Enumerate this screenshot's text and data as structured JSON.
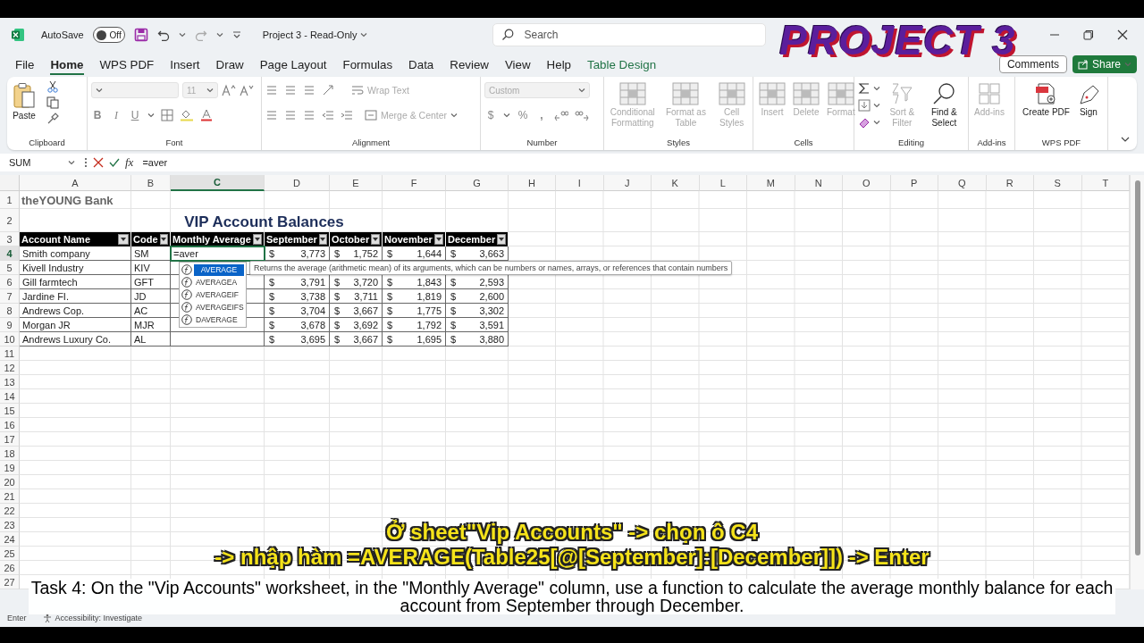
{
  "title_bar": {
    "autosave_label": "AutoSave",
    "autosave": {
      "on": false,
      "label": "Off"
    },
    "document_title": "Project 3  -  Read-Only",
    "search": {
      "placeholder": "Search"
    }
  },
  "overlay_title": "PROJECT 3",
  "ribbon_tabs": [
    {
      "label": "File",
      "selected": false,
      "contextual": false
    },
    {
      "label": "Home",
      "selected": true,
      "contextual": false
    },
    {
      "label": "WPS PDF",
      "selected": false,
      "contextual": false
    },
    {
      "label": "Insert",
      "selected": false,
      "contextual": false
    },
    {
      "label": "Draw",
      "selected": false,
      "contextual": false
    },
    {
      "label": "Page Layout",
      "selected": false,
      "contextual": false
    },
    {
      "label": "Formulas",
      "selected": false,
      "contextual": false
    },
    {
      "label": "Data",
      "selected": false,
      "contextual": false
    },
    {
      "label": "Review",
      "selected": false,
      "contextual": false
    },
    {
      "label": "View",
      "selected": false,
      "contextual": false
    },
    {
      "label": "Help",
      "selected": false,
      "contextual": false
    },
    {
      "label": "Table Design",
      "selected": false,
      "contextual": true
    }
  ],
  "comments_button": "Comments",
  "share_button": "Share",
  "ribbon": {
    "clipboard": {
      "label": "Clipboard",
      "paste": "Paste"
    },
    "font": {
      "label": "Font",
      "size": "11",
      "bold": "B",
      "italic": "I",
      "underline": "U"
    },
    "alignment": {
      "label": "Alignment",
      "wrap_text": "Wrap Text",
      "merge_center": "Merge & Center"
    },
    "number": {
      "label": "Number",
      "format": "Custom",
      "currency": "$",
      "percent": "%",
      "comma": ","
    },
    "styles": {
      "label": "Styles",
      "buttons": [
        {
          "label": "Conditional Formatting",
          "disabled": true
        },
        {
          "label": "Format as Table",
          "disabled": true
        },
        {
          "label": "Cell Styles",
          "disabled": true
        }
      ]
    },
    "cells": {
      "label": "Cells",
      "buttons": [
        {
          "label": "Insert",
          "disabled": true
        },
        {
          "label": "Delete",
          "disabled": true
        },
        {
          "label": "Format",
          "disabled": true
        }
      ]
    },
    "editing": {
      "label": "Editing",
      "buttons": [
        {
          "label": "Sort & Filter",
          "disabled": true
        },
        {
          "label": "Find & Select",
          "disabled": false
        }
      ]
    },
    "addins": {
      "label": "Add-ins",
      "buttons": [
        {
          "label": "Add-ins",
          "disabled": true
        }
      ]
    },
    "wps_pdf": {
      "label": "WPS PDF",
      "buttons": [
        {
          "label": "Create PDF",
          "disabled": false
        },
        {
          "label": "Sign",
          "disabled": false
        }
      ]
    }
  },
  "formula_bar": {
    "name_box": "SUM",
    "fx": "fx",
    "formula": "=aver"
  },
  "sheet": {
    "column_headers": [
      {
        "label": "A",
        "selected": false
      },
      {
        "label": "B",
        "selected": false
      },
      {
        "label": "C",
        "selected": true
      },
      {
        "label": "D",
        "selected": false
      },
      {
        "label": "E",
        "selected": false
      },
      {
        "label": "F",
        "selected": false
      },
      {
        "label": "G",
        "selected": false
      },
      {
        "label": "H",
        "selected": false
      },
      {
        "label": "I",
        "selected": false
      },
      {
        "label": "J",
        "selected": false
      },
      {
        "label": "K",
        "selected": false
      },
      {
        "label": "L",
        "selected": false
      },
      {
        "label": "M",
        "selected": false
      },
      {
        "label": "N",
        "selected": false
      },
      {
        "label": "O",
        "selected": false
      },
      {
        "label": "P",
        "selected": false
      },
      {
        "label": "Q",
        "selected": false
      },
      {
        "label": "R",
        "selected": false
      },
      {
        "label": "S",
        "selected": false
      },
      {
        "label": "T",
        "selected": false
      }
    ],
    "row_headers": [
      {
        "label": "1",
        "selected": false
      },
      {
        "label": "2",
        "selected": false
      },
      {
        "label": "3",
        "selected": false
      },
      {
        "label": "4",
        "selected": true
      },
      {
        "label": "5",
        "selected": false
      },
      {
        "label": "6",
        "selected": false
      },
      {
        "label": "7",
        "selected": false
      },
      {
        "label": "8",
        "selected": false
      },
      {
        "label": "9",
        "selected": false
      },
      {
        "label": "10",
        "selected": false
      },
      {
        "label": "11",
        "selected": false
      },
      {
        "label": "12",
        "selected": false
      },
      {
        "label": "13",
        "selected": false
      },
      {
        "label": "14",
        "selected": false
      },
      {
        "label": "15",
        "selected": false
      },
      {
        "label": "16",
        "selected": false
      },
      {
        "label": "17",
        "selected": false
      },
      {
        "label": "18",
        "selected": false
      },
      {
        "label": "19",
        "selected": false
      },
      {
        "label": "20",
        "selected": false
      },
      {
        "label": "21",
        "selected": false
      },
      {
        "label": "22",
        "selected": false
      },
      {
        "label": "23",
        "selected": false
      },
      {
        "label": "24",
        "selected": false
      },
      {
        "label": "25",
        "selected": false
      },
      {
        "label": "26",
        "selected": false
      },
      {
        "label": "27",
        "selected": false
      }
    ],
    "bank_name": "theYOUNG Bank",
    "title": "VIP Account Balances",
    "table": {
      "columns": [
        "Account Name",
        "Code",
        "Monthly Average",
        "September",
        "October",
        "November",
        "December"
      ],
      "rows": [
        {
          "account": "Smith company",
          "code": "SM",
          "selected": true,
          "monthly_average": "=aver",
          "months": [
            {
              "symbol": "$",
              "value": "3,773"
            },
            {
              "symbol": "$",
              "value": "1,752"
            },
            {
              "symbol": "$",
              "value": "1,644"
            },
            {
              "symbol": "$",
              "value": "3,663"
            }
          ]
        },
        {
          "account": "Kivell Industry",
          "code": "KIV",
          "selected": false
        },
        {
          "account": "Gill farmtech",
          "code": "GFT",
          "selected": false,
          "months": [
            {
              "symbol": "$",
              "value": "3,791"
            },
            {
              "symbol": "$",
              "value": "3,720"
            },
            {
              "symbol": "$",
              "value": "1,843"
            },
            {
              "symbol": "$",
              "value": "2,593"
            }
          ]
        },
        {
          "account": "Jardine FI.",
          "code": "JD",
          "selected": false,
          "months": [
            {
              "symbol": "$",
              "value": "3,738"
            },
            {
              "symbol": "$",
              "value": "3,711"
            },
            {
              "symbol": "$",
              "value": "1,819"
            },
            {
              "symbol": "$",
              "value": "2,600"
            }
          ]
        },
        {
          "account": "Andrews Cop.",
          "code": "AC",
          "selected": false,
          "months": [
            {
              "symbol": "$",
              "value": "3,704"
            },
            {
              "symbol": "$",
              "value": "3,667"
            },
            {
              "symbol": "$",
              "value": "1,775"
            },
            {
              "symbol": "$",
              "value": "3,302"
            }
          ]
        },
        {
          "account": "Morgan JR",
          "code": "MJR",
          "selected": false,
          "months": [
            {
              "symbol": "$",
              "value": "3,678"
            },
            {
              "symbol": "$",
              "value": "3,692"
            },
            {
              "symbol": "$",
              "value": "1,792"
            },
            {
              "symbol": "$",
              "value": "3,591"
            }
          ]
        },
        {
          "account": "Andrews Luxury Co.",
          "code": "AL",
          "selected": false,
          "months": [
            {
              "symbol": "$",
              "value": "3,695"
            },
            {
              "symbol": "$",
              "value": "3,667"
            },
            {
              "symbol": "$",
              "value": "1,695"
            },
            {
              "symbol": "$",
              "value": "3,880"
            }
          ]
        }
      ]
    },
    "autocomplete": {
      "items": [
        {
          "label": "AVERAGE",
          "selected": true
        },
        {
          "label": "AVERAGEA",
          "selected": false
        },
        {
          "label": "AVERAGEIF",
          "selected": false
        },
        {
          "label": "AVERAGEIFS",
          "selected": false
        },
        {
          "label": "DAVERAGE",
          "selected": false
        }
      ],
      "tooltip": "Returns the average (arithmetic mean) of its arguments, which can be numbers or names, arrays, or references that contain numbers"
    }
  },
  "subtitles": {
    "lines": [
      "Ở sheet\"Vip Accounts\" -> chọn ô C4",
      "-> nhập hàm =AVERAGE(Table25[@[September]:[December]]) -> Enter"
    ],
    "caption": "Task 4: On the \"Vip Accounts\" worksheet, in the \"Monthly Average\" column, use a function to calculate the average monthly balance for each account from September through December."
  },
  "status_bar": {
    "mode": "Enter",
    "accessibility": "Accessibility: Investigate"
  }
}
